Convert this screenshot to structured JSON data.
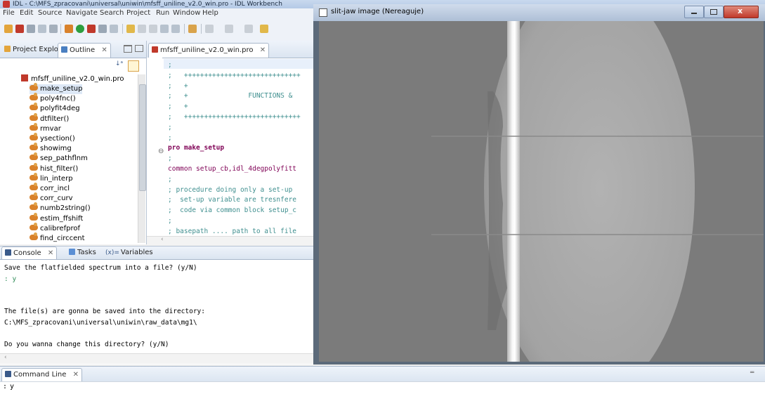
{
  "main_window": {
    "title": "IDL - C:\\MFS_zpracovani\\universal\\uniwin\\mfsff_uniline_v2.0_win.pro - IDL Workbench"
  },
  "menu": [
    "File",
    "Edit",
    "Source",
    "Navigate",
    "Search",
    "Project",
    "Run",
    "Window",
    "Help"
  ],
  "left_panel": {
    "tabs": [
      {
        "label": "Project Explore",
        "active": false
      },
      {
        "label": "Outline",
        "active": true
      }
    ],
    "file_name": "mfsff_uniline_v2.0_win.pro",
    "items": [
      "make_setup",
      "poly4fnc()",
      "polyfit4deg",
      "dtfilter()",
      "rmvar",
      "ysection()",
      "showimg",
      "sep_pathflnm",
      "hist_filter()",
      "lin_interp",
      "corr_incl",
      "corr_curv",
      "numb2string()",
      "estim_ffshift",
      "calibrefprof",
      "find_circcent"
    ],
    "selected_item": "make_setup"
  },
  "editor": {
    "tab_label": "mfsff_uniline_v2.0_win.pro",
    "lines": [
      {
        "text": ";",
        "kind": "cmt"
      },
      {
        "text": ";   +++++++++++++++++++++++++++++",
        "kind": "cmt"
      },
      {
        "text": ";   +",
        "kind": "cmt"
      },
      {
        "text": ";   +               FUNCTIONS & ",
        "kind": "cmt"
      },
      {
        "text": ";   +",
        "kind": "cmt"
      },
      {
        "text": ";   +++++++++++++++++++++++++++++",
        "kind": "cmt"
      },
      {
        "text": ";",
        "kind": "cmt"
      },
      {
        "text": ";",
        "kind": "cmt"
      },
      {
        "text": "pro make_setup",
        "kind": "kw"
      },
      {
        "text": ";",
        "kind": "cmt"
      },
      {
        "text": "common setup_cb,idl_4degpolyfitt",
        "kind": "kwplain"
      },
      {
        "text": ";",
        "kind": "cmt"
      },
      {
        "text": "; procedure doing only a set-up ",
        "kind": "cmt"
      },
      {
        "text": ";  set-up variable are tresnfere",
        "kind": "cmt"
      },
      {
        "text": ";  code via common block setup_c",
        "kind": "cmt"
      },
      {
        "text": ";",
        "kind": "cmt"
      },
      {
        "text": "; basepath .... path to all file",
        "kind": "cmt"
      }
    ]
  },
  "console": {
    "tabs": [
      "Console",
      "Tasks",
      "Variables"
    ],
    "lines": [
      {
        "text": "Save the flatfielded spectrum into a file? (y/N)",
        "color": "#000"
      },
      {
        "text": ": y",
        "color": "#2e8b57"
      },
      {
        "text": "",
        "color": "#000"
      },
      {
        "text": "",
        "color": "#000"
      },
      {
        "text": "The file(s) are gonna be saved into the directory:",
        "color": "#000"
      },
      {
        "text": "C:\\MFS_zpracovani\\universal\\uniwin\\raw_data\\mg1\\",
        "color": "#000"
      },
      {
        "text": "",
        "color": "#000"
      },
      {
        "text": "Do you wanna change this directory? (y/N)",
        "color": "#000"
      }
    ]
  },
  "command_line": {
    "label": "Command Line",
    "prompt": ":",
    "value": "y"
  },
  "slit_jaw": {
    "title": "slit-jaw image (Nereaguje)"
  },
  "colors": {
    "keyword": "#7f0055",
    "comment": "#3f8f8f",
    "console_input": "#2e8b57",
    "image_background": "#7b7b7b",
    "image_disk": "#a9a9a9",
    "slit_line": "#f5f5f5"
  },
  "icons": {
    "close": "close-icon",
    "minimize": "minimize-icon",
    "maximize": "maximize-icon"
  }
}
